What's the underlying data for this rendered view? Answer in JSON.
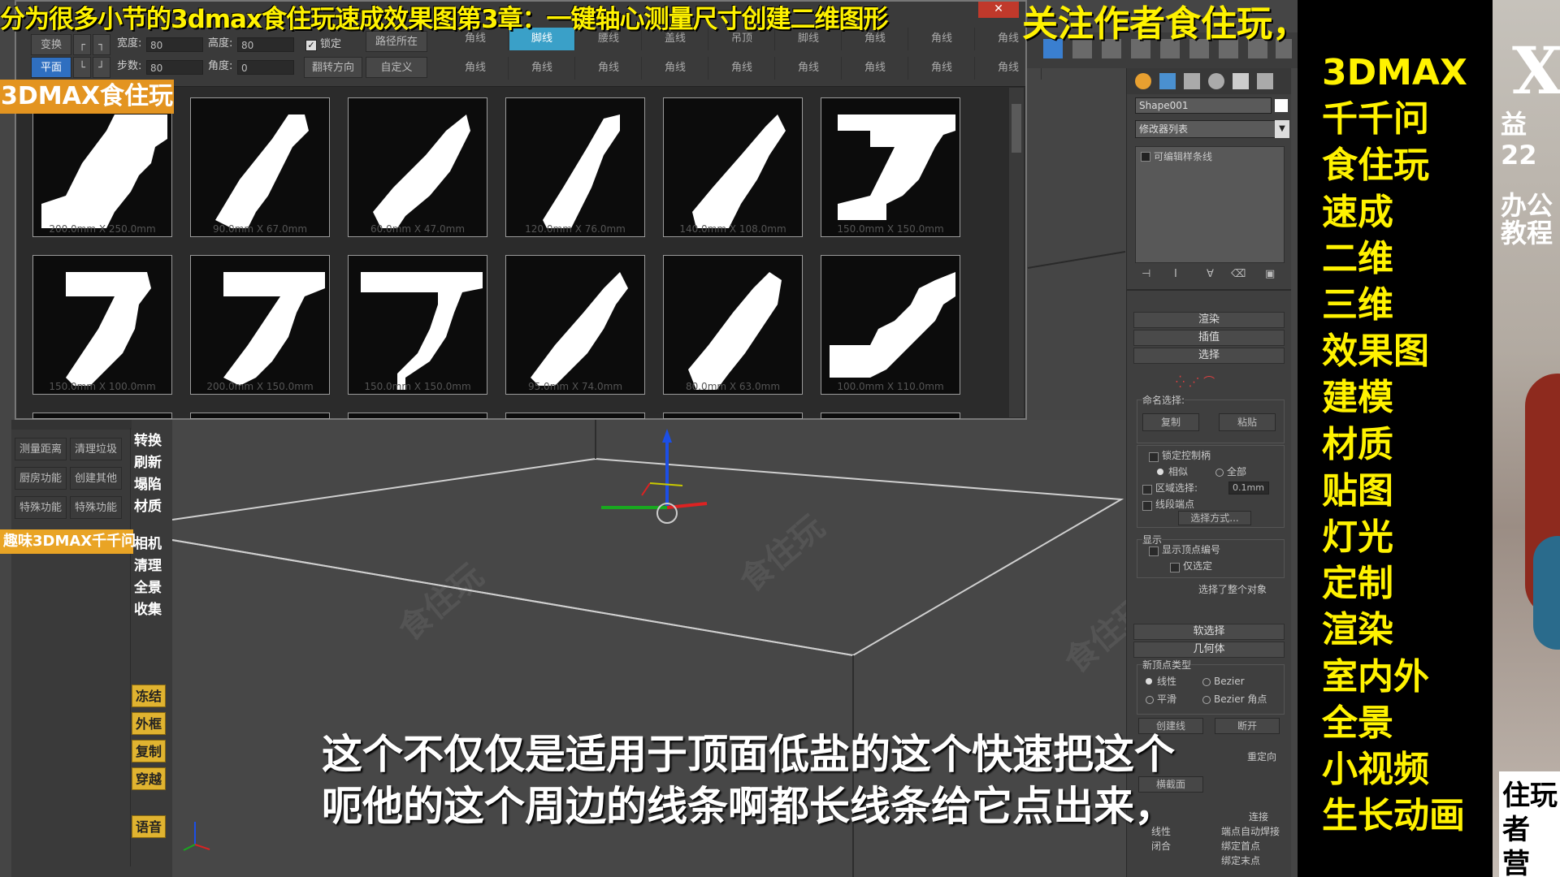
{
  "banner": {
    "title_left": "分为很多小节的3dmax食住玩速成效果图第3章：一键轴心测量尺寸创建二维图形",
    "title_right": "关注作者食住玩，设计办公不难"
  },
  "tags": {
    "top_tag": "3DMAX食住玩",
    "side_tag": "趣味3DMAX千千问"
  },
  "panel": {
    "row1": {
      "btn1": "变换",
      "lbl_width": "宽度:",
      "val_width": "80",
      "lbl_height": "高度:",
      "val_height": "80",
      "lock": "锁定",
      "path": "路径所在"
    },
    "row2": {
      "btn1": "平面",
      "lbl_steps": "步数:",
      "val_steps": "80",
      "lbl_angle": "角度:",
      "val_angle": "0",
      "flip": "翻转方向",
      "custom": "自定义"
    },
    "tabs_row1": [
      "角线",
      "脚线",
      "腰线",
      "盖线",
      "吊顶",
      "脚线",
      "角线",
      "角线",
      "角线"
    ],
    "tabs_row2": [
      "角线",
      "角线",
      "角线",
      "角线",
      "角线",
      "角线",
      "角线",
      "角线",
      "角线"
    ],
    "tiles": [
      {
        "caption": "200.0mm X 250.0mm"
      },
      {
        "caption": "90.0mm X 67.0mm"
      },
      {
        "caption": "60.0mm X 47.0mm"
      },
      {
        "caption": "120.0mm X 76.0mm"
      },
      {
        "caption": "140.0mm X 108.0mm"
      },
      {
        "caption": "150.0mm X 150.0mm"
      },
      {
        "caption": "150.0mm X 100.0mm"
      },
      {
        "caption": "200.0mm X 150.0mm"
      },
      {
        "caption": "150.0mm X 150.0mm"
      },
      {
        "caption": "95.0mm X 74.0mm"
      },
      {
        "caption": "80.0mm X 63.0mm"
      },
      {
        "caption": "100.0mm X 110.0mm"
      }
    ]
  },
  "left_panel": {
    "buttons": [
      [
        "测量距离",
        "清理垃圾"
      ],
      [
        "厨房功能",
        "创建其他"
      ],
      [
        "特殊功能",
        "特殊功能"
      ]
    ],
    "vertical": [
      "转换",
      "刷新",
      "塌陷",
      "材质",
      "相机",
      "清理",
      "全景",
      "收集"
    ],
    "yellow": [
      "冻结",
      "外框",
      "复制",
      "穿越",
      "语音"
    ]
  },
  "command_panel": {
    "object_name": "Shape001",
    "modifier_list": "修改器列表",
    "stack_item": "可编辑样条线",
    "rollouts": {
      "render": "渲染",
      "interp": "插值",
      "select": "选择",
      "soft": "软选择",
      "geometry": "几何体"
    },
    "named_sel": "命名选择:",
    "copy": "复制",
    "paste": "粘贴",
    "lock_handles": "锁定控制柄",
    "similar": "相似",
    "all": "全部",
    "area_sel": "区域选择:",
    "area_val": "0.1mm",
    "segment_end": "线段端点",
    "select_by": "选择方式...",
    "display": "显示",
    "show_vertex_num": "显示顶点编号",
    "only_selected": "仅选定",
    "whole_selected": "选择了整个对象",
    "new_vertex_type": "新顶点类型",
    "linear": "线性",
    "bezier": "Bezier",
    "smooth": "平滑",
    "bezier_corner": "Bezier 角点",
    "create_line": "创建线",
    "break": "断开",
    "reorient": "重定向",
    "cross_section": "横截面",
    "connect": "连接",
    "end_point_auto": "端点自动焊接",
    "lines": "线性",
    "closed": "闭合",
    "bind_first": "绑定首点",
    "bind_last": "绑定末点"
  },
  "right_column": {
    "words": [
      "3DMAX",
      "千千问",
      "食住玩",
      "速成",
      "二维",
      "三维",
      "效果图",
      "建模",
      "材质",
      "贴图",
      "灯光",
      "定制",
      "渲染",
      "室内外",
      "全景",
      "小视频",
      "生长动画"
    ]
  },
  "far_right": {
    "big_letter": "X",
    "lines": [
      "益",
      "22",
      "办公",
      "教程"
    ],
    "bottom": [
      "住玩",
      "者",
      "营"
    ]
  },
  "subtitle": {
    "line1": "这个不仅仅是适用于顶面低盐的这个快速把这个",
    "line2": "呃他的这个周边的线条啊都长线条给它点出来，"
  },
  "watermark": "食住玩"
}
